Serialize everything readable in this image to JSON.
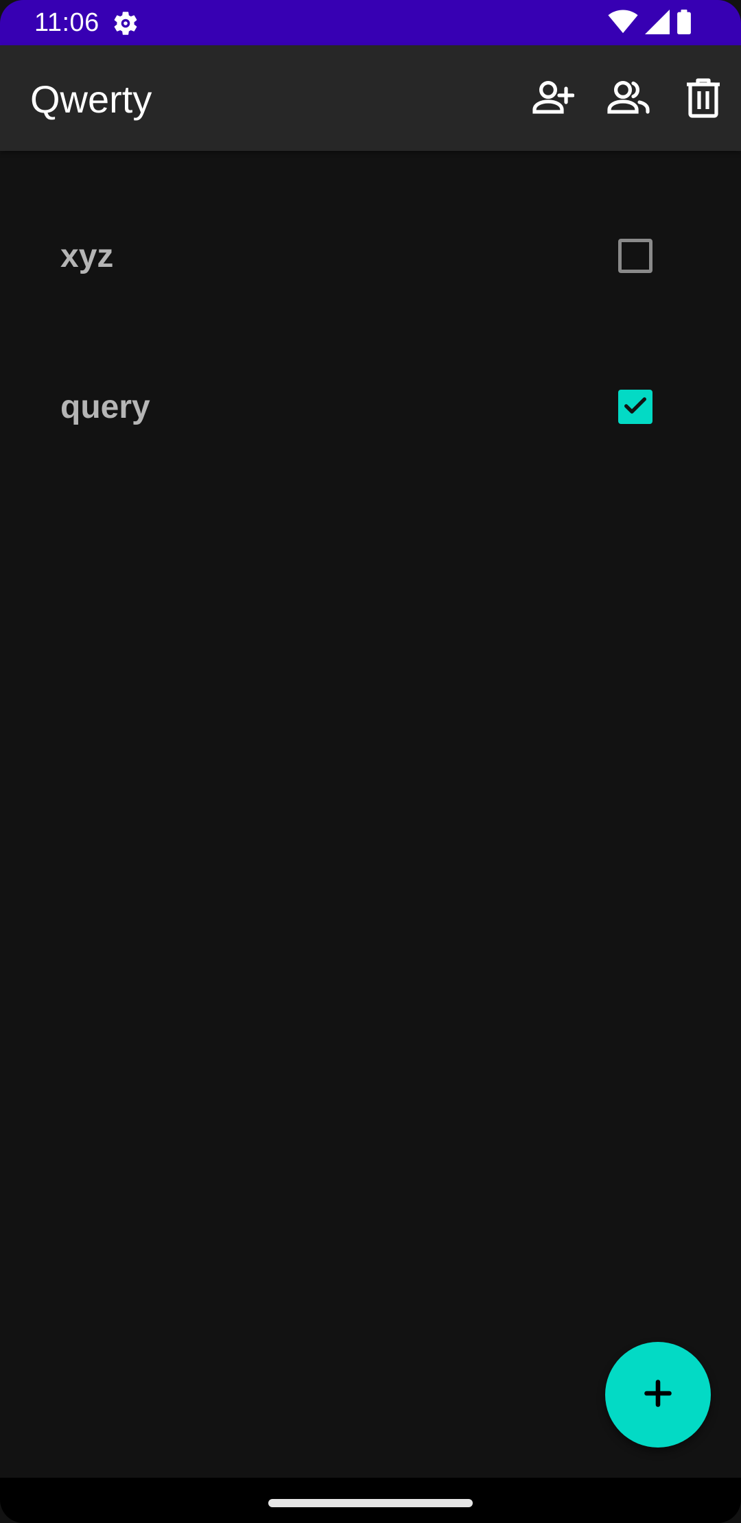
{
  "status_bar": {
    "time": "11:06",
    "background": "#3700b3",
    "icons": [
      "settings-gear-icon",
      "wifi-icon",
      "cell-signal-icon",
      "battery-icon"
    ]
  },
  "app_bar": {
    "title": "Qwerty",
    "background": "#272727",
    "actions": [
      "add-person-icon",
      "people-icon",
      "delete-icon"
    ]
  },
  "list": {
    "items": [
      {
        "label": "xyz",
        "checked": false
      },
      {
        "label": "query",
        "checked": true
      }
    ]
  },
  "fab": {
    "icon": "plus-icon",
    "color": "#03dac5"
  },
  "colors": {
    "accent": "#03dac5",
    "background": "#121212",
    "item_text": "#b5b5b5"
  }
}
